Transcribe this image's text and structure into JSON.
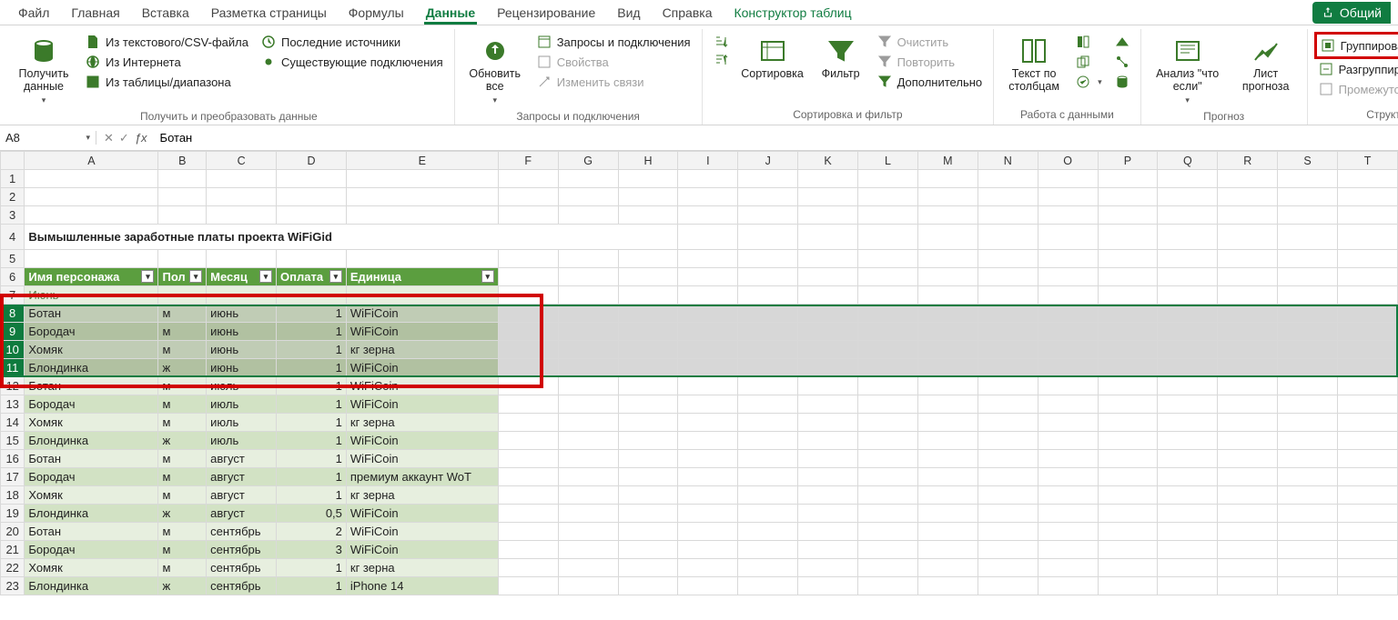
{
  "menu": {
    "tabs": [
      "Файл",
      "Главная",
      "Вставка",
      "Разметка страницы",
      "Формулы",
      "Данные",
      "Рецензирование",
      "Вид",
      "Справка"
    ],
    "contextual": "Конструктор таблиц",
    "active_index": 5,
    "share_label": "Общий"
  },
  "ribbon": {
    "groups": {
      "get_transform": {
        "label": "Получить и преобразовать данные",
        "big": {
          "label": "Получить\nданные"
        },
        "items": [
          "Из текстового/CSV-файла",
          "Из Интернета",
          "Из таблицы/диапазона",
          "Последние источники",
          "Существующие подключения"
        ]
      },
      "queries": {
        "label": "Запросы и подключения",
        "big": {
          "label": "Обновить\nвсе"
        },
        "items": [
          "Запросы и подключения",
          "Свойства",
          "Изменить связи"
        ]
      },
      "sort_filter": {
        "label": "Сортировка и фильтр",
        "sort_big": "Сортировка",
        "filter_big": "Фильтр",
        "items": [
          "Очистить",
          "Повторить",
          "Дополнительно"
        ]
      },
      "data_tools": {
        "label": "Работа с данными",
        "big": {
          "label": "Текст по\nстолбцам"
        }
      },
      "forecast": {
        "label": "Прогноз",
        "whatif": "Анализ \"что\nесли\"",
        "sheet": "Лист\nпрогноза"
      },
      "outline": {
        "label": "Структура",
        "group": "Группировать",
        "ungroup": "Разгруппировать",
        "subtotal": "Промежуточный итог"
      }
    }
  },
  "formula_bar": {
    "name_box": "A8",
    "formula": "Ботан"
  },
  "sheet": {
    "columns": [
      "A",
      "B",
      "C",
      "D",
      "E",
      "F",
      "G",
      "H",
      "I",
      "J",
      "K",
      "L",
      "M",
      "N",
      "O",
      "P",
      "Q",
      "R",
      "S",
      "T"
    ],
    "title_row": 4,
    "title": "Вымышленные заработные платы проекта WiFiGid",
    "header_row": 6,
    "headers": [
      "Имя персонажа",
      "Пол",
      "Месяц",
      "Оплата",
      "Единица"
    ],
    "group_row": {
      "row": 7,
      "label": "Июнь"
    },
    "rows": [
      {
        "row": 8,
        "sel": true,
        "band": "even",
        "cells": [
          "Ботан",
          "м",
          "июнь",
          "1",
          "WiFiCoin"
        ]
      },
      {
        "row": 9,
        "sel": true,
        "band": "odd",
        "cells": [
          "Бородач",
          "м",
          "июнь",
          "1",
          "WiFiCoin"
        ]
      },
      {
        "row": 10,
        "sel": true,
        "band": "even",
        "cells": [
          "Хомяк",
          "м",
          "июнь",
          "1",
          "кг зерна"
        ]
      },
      {
        "row": 11,
        "sel": true,
        "band": "odd",
        "cells": [
          "Блондинка",
          "ж",
          "июнь",
          "1",
          "WiFiCoin"
        ]
      },
      {
        "row": 12,
        "sel": false,
        "band": "even",
        "cells": [
          "Ботан",
          "м",
          "июль",
          "1",
          "WiFiCoin"
        ]
      },
      {
        "row": 13,
        "sel": false,
        "band": "odd",
        "cells": [
          "Бородач",
          "м",
          "июль",
          "1",
          "WiFiCoin"
        ]
      },
      {
        "row": 14,
        "sel": false,
        "band": "even",
        "cells": [
          "Хомяк",
          "м",
          "июль",
          "1",
          "кг зерна"
        ]
      },
      {
        "row": 15,
        "sel": false,
        "band": "odd",
        "cells": [
          "Блондинка",
          "ж",
          "июль",
          "1",
          "WiFiCoin"
        ]
      },
      {
        "row": 16,
        "sel": false,
        "band": "even",
        "cells": [
          "Ботан",
          "м",
          "август",
          "1",
          "WiFiCoin"
        ]
      },
      {
        "row": 17,
        "sel": false,
        "band": "odd",
        "cells": [
          "Бородач",
          "м",
          "август",
          "1",
          "премиум аккаунт WoT"
        ]
      },
      {
        "row": 18,
        "sel": false,
        "band": "even",
        "cells": [
          "Хомяк",
          "м",
          "август",
          "1",
          "кг зерна"
        ]
      },
      {
        "row": 19,
        "sel": false,
        "band": "odd",
        "cells": [
          "Блондинка",
          "ж",
          "август",
          "0,5",
          "WiFiCoin"
        ]
      },
      {
        "row": 20,
        "sel": false,
        "band": "even",
        "cells": [
          "Ботан",
          "м",
          "сентябрь",
          "2",
          "WiFiCoin"
        ]
      },
      {
        "row": 21,
        "sel": false,
        "band": "odd",
        "cells": [
          "Бородач",
          "м",
          "сентябрь",
          "3",
          "WiFiCoin"
        ]
      },
      {
        "row": 22,
        "sel": false,
        "band": "even",
        "cells": [
          "Хомяк",
          "м",
          "сентябрь",
          "1",
          "кг зерна"
        ]
      },
      {
        "row": 23,
        "sel": false,
        "band": "odd",
        "cells": [
          "Блондинка",
          "ж",
          "сентябрь",
          "1",
          "iPhone 14"
        ]
      }
    ]
  }
}
